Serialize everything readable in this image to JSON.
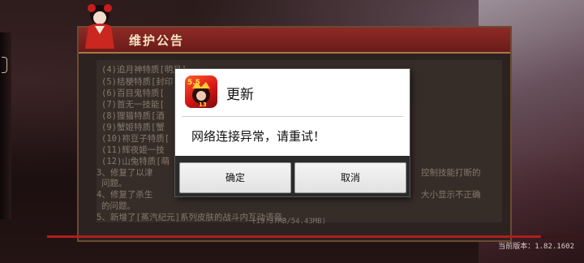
{
  "notice": {
    "title": "维护公告",
    "lines": [
      "(4)追月神特质[明月]",
      "(5)桔梗特质[封印",
      "(6)百目鬼特质[",
      "(7)首无一技能[",
      "(8)狸猫特质[酒",
      "(9)蟹姬特质[蟹",
      "(10)祢豆子特质[",
      "(11)辉夜姬一技",
      "(12)山兔特质[萌",
      "3、修复了以津",
      "问题。",
      "4、修复了杀生",
      "的问题。",
      "5、新增了[蒸汽纪元]系列皮肤的战斗内互动语音。"
    ],
    "right_fragments": {
      "line_a": "控制技能打断的",
      "line_b": "大小显示不正确"
    }
  },
  "progress": {
    "text": "(13.37MB/54.43MB)",
    "fraction": 0.92
  },
  "version": "当前版本：1.82.1602",
  "dialog": {
    "title": "更新",
    "message": "网络连接异常，请重试！",
    "confirm_label": "确定",
    "cancel_label": "取消",
    "app_icon_badge": "5.5",
    "app_icon_sub": "13"
  },
  "colors": {
    "header_red": "#8d2a26",
    "progress_red": "#b01e1e",
    "dialog_bg": "#ffffff"
  },
  "icons": {
    "app": "onmyoji-app-icon",
    "mascot": "shrine-maiden-mascot"
  }
}
